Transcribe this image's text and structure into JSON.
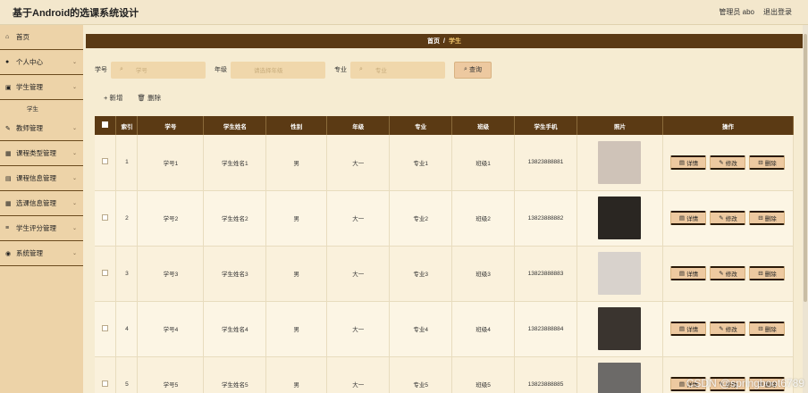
{
  "app": {
    "title": "基于Android的选课系统设计"
  },
  "header": {
    "user_label": "管理员 abo",
    "logout_label": "退出登录"
  },
  "sidebar": {
    "items": [
      {
        "label": "首页",
        "icon": "home-icon",
        "glyph": "⌂",
        "has_children": false
      },
      {
        "label": "个人中心",
        "icon": "user-icon",
        "glyph": "●",
        "has_children": true
      },
      {
        "label": "学生管理",
        "icon": "bag-icon",
        "glyph": "▣",
        "has_children": true
      },
      {
        "label": "教师管理",
        "icon": "teacher-icon",
        "glyph": "✎",
        "has_children": true
      },
      {
        "label": "课程类型管理",
        "icon": "grid-icon",
        "glyph": "▦",
        "has_children": true
      },
      {
        "label": "课程信息管理",
        "icon": "book-icon",
        "glyph": "▤",
        "has_children": true
      },
      {
        "label": "选课信息管理",
        "icon": "grid-icon",
        "glyph": "▦",
        "has_children": true
      },
      {
        "label": "学生评分管理",
        "icon": "list-icon",
        "glyph": "≡",
        "has_children": true
      },
      {
        "label": "系统管理",
        "icon": "pin-icon",
        "glyph": "◉",
        "has_children": true
      }
    ],
    "sub_item": "学生"
  },
  "breadcrumb": {
    "home": "首页",
    "sep": "/",
    "current": "学生"
  },
  "search": {
    "fields": [
      {
        "label": "学号",
        "placeholder": "学号"
      },
      {
        "label": "年级",
        "placeholder": "请选择年级"
      },
      {
        "label": "专业",
        "placeholder": "专业"
      }
    ],
    "query_label": "查询"
  },
  "actions": {
    "add_label": "+ 新增",
    "delete_label": "删除"
  },
  "table": {
    "headers": [
      "",
      "索引",
      "学号",
      "学生姓名",
      "性别",
      "年级",
      "专业",
      "班级",
      "学生手机",
      "照片",
      "操作"
    ],
    "rows": [
      {
        "index": "1",
        "id": "学号1",
        "name": "学生姓名1",
        "gender": "男",
        "grade": "大一",
        "major": "专业1",
        "class": "班级1",
        "phone": "13823888881",
        "photo_color": "#cfc3b8"
      },
      {
        "index": "2",
        "id": "学号2",
        "name": "学生姓名2",
        "gender": "男",
        "grade": "大一",
        "major": "专业2",
        "class": "班级2",
        "phone": "13823888882",
        "photo_color": "#2a2622"
      },
      {
        "index": "3",
        "id": "学号3",
        "name": "学生姓名3",
        "gender": "男",
        "grade": "大一",
        "major": "专业3",
        "class": "班级3",
        "phone": "13823888883",
        "photo_color": "#d8d2cc"
      },
      {
        "index": "4",
        "id": "学号4",
        "name": "学生姓名4",
        "gender": "男",
        "grade": "大一",
        "major": "专业4",
        "class": "班级4",
        "phone": "13823888884",
        "photo_color": "#3a342f"
      },
      {
        "index": "5",
        "id": "学号5",
        "name": "学生姓名5",
        "gender": "男",
        "grade": "大一",
        "major": "专业5",
        "class": "班级5",
        "phone": "13823888885",
        "photo_color": "#6c6a68"
      }
    ],
    "op_labels": {
      "detail": "详情",
      "edit": "修改",
      "delete": "删除"
    }
  },
  "watermark": "CSDN @springboot6789",
  "colors": {
    "accent_dark": "#5b3a14",
    "sidebar_bg": "#edd3a8",
    "page_bg": "#f6ecd2",
    "button_bg": "#edc9a0"
  }
}
